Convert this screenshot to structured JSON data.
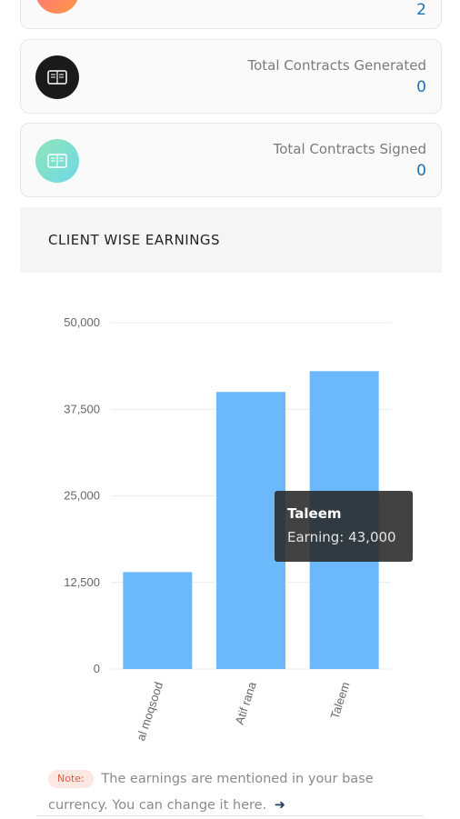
{
  "cards": [
    {
      "label": "",
      "value": "2",
      "icon": "user-icon",
      "color": "#ff7a59"
    },
    {
      "label": "Total Contracts Generated",
      "value": "0",
      "icon": "contract-icon",
      "color": "#1a1a1a"
    },
    {
      "label": "Total Contracts Signed",
      "value": "0",
      "icon": "contract-icon",
      "color": "#6ee0c0"
    }
  ],
  "section": {
    "title": "CLIENT WISE EARNINGS"
  },
  "chart_data": {
    "type": "bar",
    "categories": [
      "al moqsood",
      "Atif rana",
      "Taleem"
    ],
    "series": [
      {
        "name": "Earning",
        "values": [
          14000,
          40000,
          43000
        ]
      }
    ],
    "ylim": [
      0,
      50000
    ],
    "yticks": [
      "0",
      "12,500",
      "25,000",
      "37,500",
      "50,000"
    ],
    "ytick_values": [
      0,
      12500,
      25000,
      37500,
      50000
    ],
    "bar_color": "#6bb8fb",
    "grid": true,
    "tooltip": {
      "title": "Taleem",
      "body": "Earning: 43,000"
    }
  },
  "note": {
    "badge": "Note:",
    "text": "The earnings are mentioned in your base currency. You can change it here."
  }
}
